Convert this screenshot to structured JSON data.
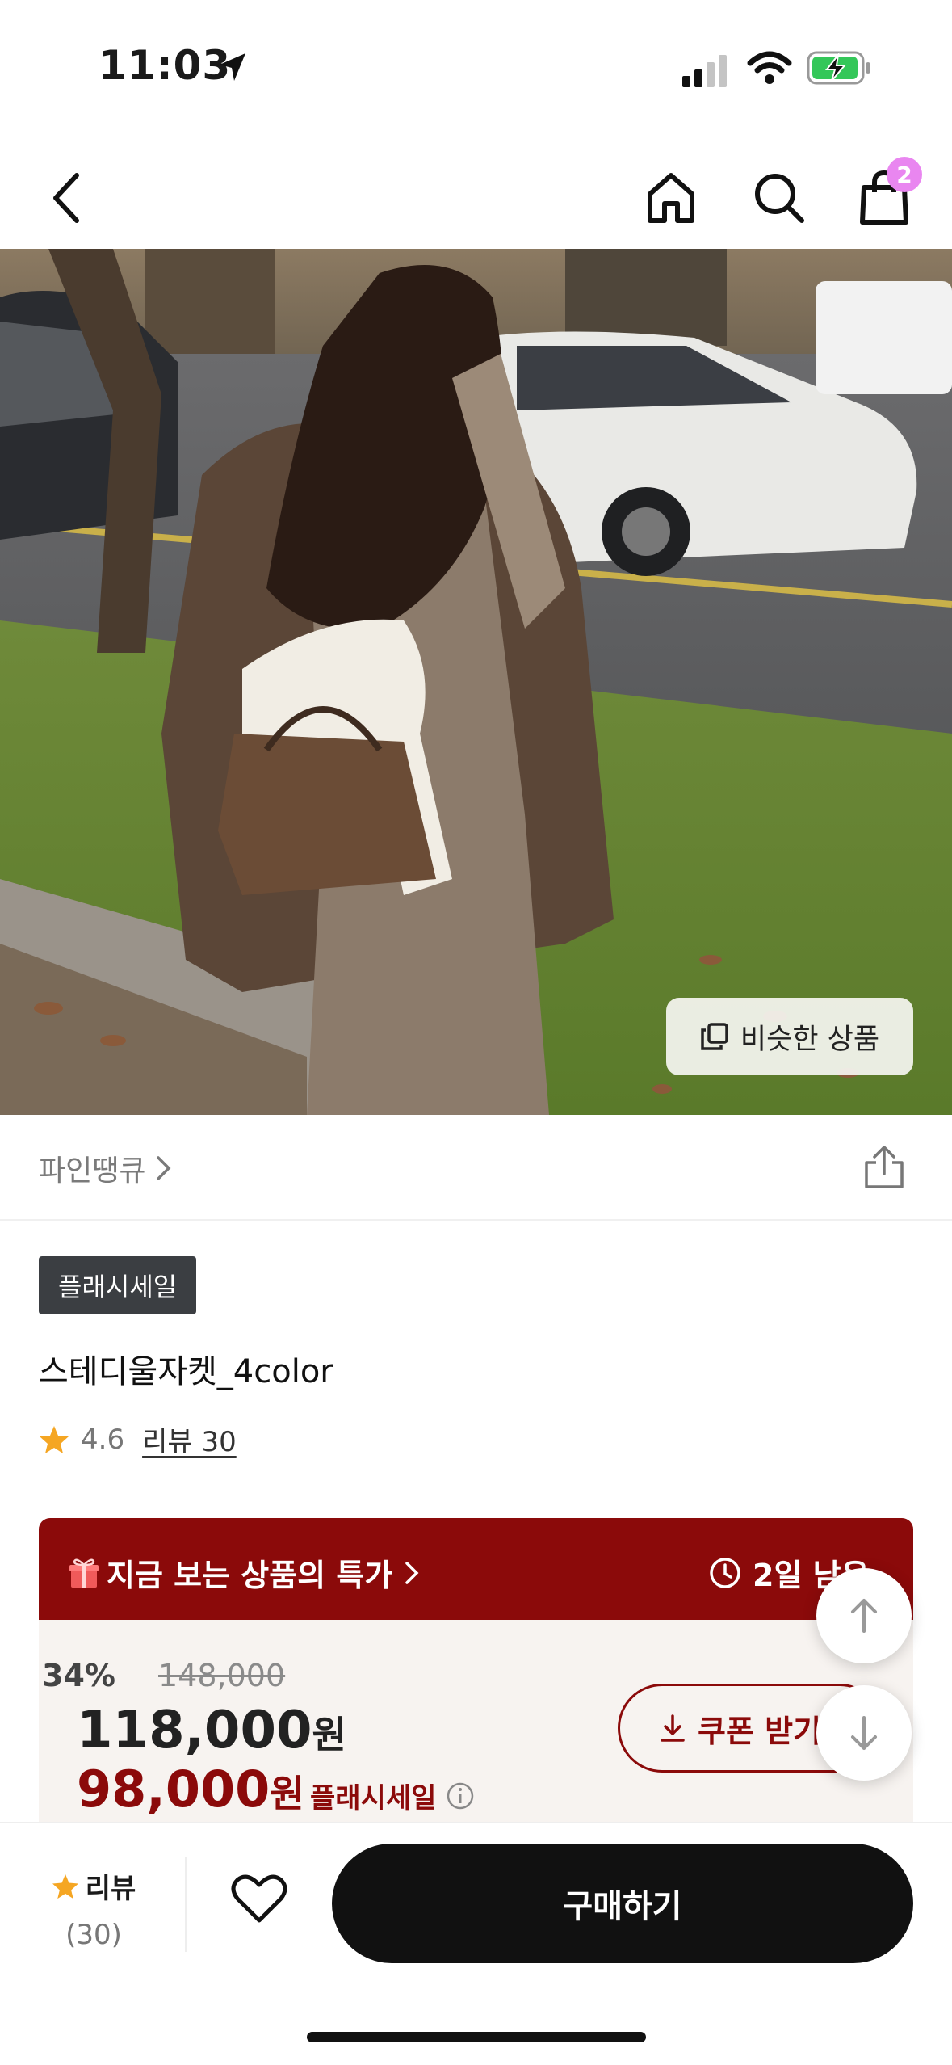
{
  "status_bar": {
    "time": "11:03"
  },
  "header": {
    "cart_count": "2"
  },
  "hero": {
    "similar_label": "비슷한 상품"
  },
  "product": {
    "brand": "파인땡큐",
    "tag": "플래시세일",
    "name": "스테디울자켓_4color",
    "rating": "4.6",
    "review_link": "리뷰 30"
  },
  "promo": {
    "title": "지금 보는 상품의 특가",
    "time_left": "2일 남은",
    "discount_rate": "34%",
    "original_price": "148,000",
    "price": "118,000",
    "price_unit": "원",
    "sale_price": "98,000",
    "sale_unit": "원",
    "sale_label": "플래시세일",
    "coupon_label": "쿠폰 받기"
  },
  "bottom_bar": {
    "review_label": "리뷰",
    "review_count": "(30)",
    "buy_label": "구매하기"
  },
  "colors": {
    "accent": "#8b0a0a",
    "badge": "#e986f0",
    "battery": "#34c759"
  }
}
